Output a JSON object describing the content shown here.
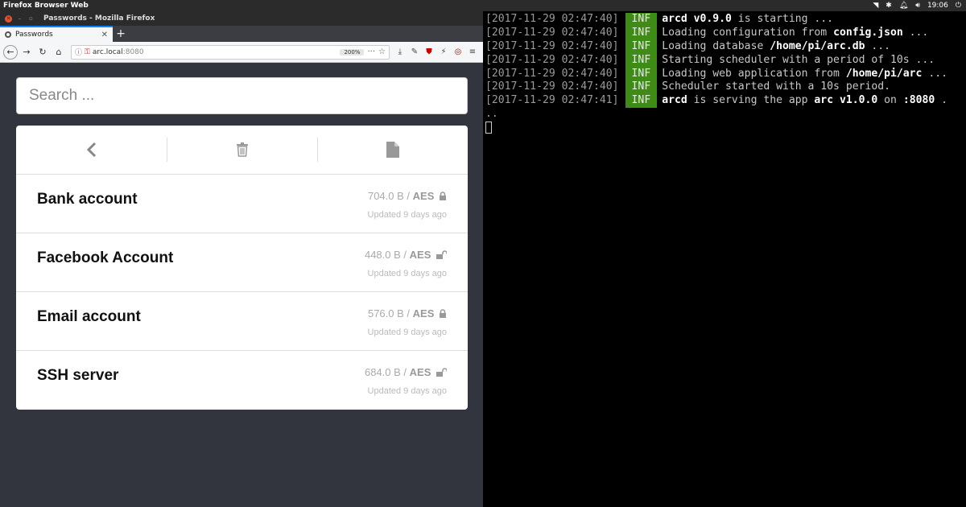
{
  "topbar": {
    "app_name": "Firefox Browser Web",
    "time": "19:06"
  },
  "firefox": {
    "window_title": "Passwords - Mozilla Firefox",
    "tab_label": "Passwords",
    "url_host": "arc.local",
    "url_port": ":8080",
    "zoom": "200%"
  },
  "app": {
    "search_placeholder": "Search ...",
    "entries": [
      {
        "title": "Bank account",
        "size": "704.0 B /",
        "enc": "AES",
        "locked": true,
        "updated": "Updated 9 days ago"
      },
      {
        "title": "Facebook Account",
        "size": "448.0 B /",
        "enc": "AES",
        "locked": false,
        "updated": "Updated 9 days ago"
      },
      {
        "title": "Email account",
        "size": "576.0 B /",
        "enc": "AES",
        "locked": true,
        "updated": "Updated 9 days ago"
      },
      {
        "title": "SSH server",
        "size": "684.0 B /",
        "enc": "AES",
        "locked": false,
        "updated": "Updated 9 days ago"
      }
    ]
  },
  "terminal": {
    "level": "INF",
    "lines": [
      {
        "ts": "[2017-11-29 02:47:40]",
        "parts": [
          [
            "b",
            "arcd v0.9.0"
          ],
          [
            "n",
            " is starting ..."
          ]
        ]
      },
      {
        "ts": "[2017-11-29 02:47:40]",
        "parts": [
          [
            "n",
            "Loading configuration from "
          ],
          [
            "b",
            "config.json"
          ],
          [
            "n",
            " ..."
          ]
        ]
      },
      {
        "ts": "[2017-11-29 02:47:40]",
        "parts": [
          [
            "n",
            "Loading database "
          ],
          [
            "b",
            "/home/pi/arc.db"
          ],
          [
            "n",
            " ..."
          ]
        ]
      },
      {
        "ts": "[2017-11-29 02:47:40]",
        "parts": [
          [
            "n",
            "Starting scheduler with a period of 10s ..."
          ]
        ]
      },
      {
        "ts": "[2017-11-29 02:47:40]",
        "parts": [
          [
            "n",
            "Loading web application from "
          ],
          [
            "b",
            "/home/pi/arc"
          ],
          [
            "n",
            " ..."
          ]
        ]
      },
      {
        "ts": "[2017-11-29 02:47:40]",
        "parts": [
          [
            "n",
            "Scheduler started with a 10s period."
          ]
        ]
      },
      {
        "ts": "[2017-11-29 02:47:41]",
        "parts": [
          [
            "b",
            "arcd"
          ],
          [
            "n",
            " is serving the app "
          ],
          [
            "b",
            "arc v1.0.0"
          ],
          [
            "n",
            " on "
          ],
          [
            "b",
            ":8080"
          ],
          [
            "n",
            " ."
          ]
        ]
      }
    ],
    "wrap": ".."
  }
}
